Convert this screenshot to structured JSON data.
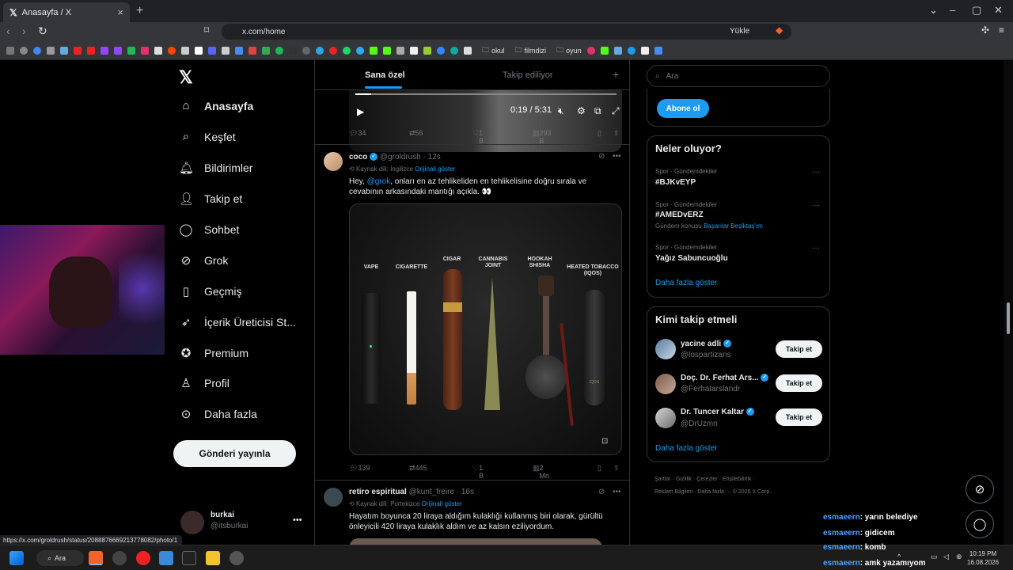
{
  "browser": {
    "tab_title": "Anasayfa / X",
    "url": "x.com/home",
    "download_label": "Yükle",
    "bookmark_folders": [
      "okul",
      "filmdizi",
      "oyun"
    ],
    "status_url": "https://x.com/groldrush/status/20888766692137780​82/photo/1"
  },
  "nav": {
    "items": [
      "Anasayfa",
      "Keşfet",
      "Bildirimler",
      "Takip et",
      "Sohbet",
      "Grok",
      "Geçmiş",
      "İçerik Üreticisi St...",
      "Premium",
      "Profil",
      "Daha fazla"
    ],
    "post_button": "Gönderi yayınla",
    "account_name": "burkai",
    "account_handle": "@itsburkai"
  },
  "timeline": {
    "tab_for_you": "Sana özel",
    "tab_following": "Takip ediliyor",
    "video": {
      "time": "0:19 / 5:31",
      "progress": 0.06
    },
    "post0_stats": {
      "replies": "34",
      "reposts": "56",
      "likes": "1 B",
      "views": "293 B"
    },
    "post1": {
      "name": "coco",
      "handle": "@groldrush",
      "time": "· 12s",
      "lang_note": "Kaynak dili: İngilizce",
      "show_original": "Orijinali göster",
      "text_before": "Hey, ",
      "mention": "@grok",
      "text_after": ", onları en az tehlikeliden en tehlikelisine doğru sırala ve cevabının arkasındaki mantığı açıkla. 👀",
      "labels": [
        "VAPE",
        "CIGARETTE",
        "CIGAR",
        "CANNABIS JOINT",
        "HOOKAH SHISHA",
        "HEATED TOBACCO (IQOS)"
      ],
      "iqos_mark": "IQOS",
      "stats": {
        "replies": "139",
        "reposts": "445",
        "likes": "1 B",
        "views": "2 Mn"
      }
    },
    "post2": {
      "name": "retiro espiritual",
      "handle": "@kunt_freire",
      "time": "· 16s",
      "lang_note": "Kaynak dili: Portekizce",
      "show_original": "Orijinali göster",
      "text": "Hayatım boyunca 20 liraya aldığım kulaklığı kullanmış biri olarak, gürültü önleyicili 420 liraya kulaklık aldım ve az kalsın eziliyordum."
    }
  },
  "sidebar": {
    "search_placeholder": "Ara",
    "subscribe": "Abone ol",
    "trends_title": "Neler oluyor?",
    "trends": [
      {
        "category": "Spor · Gündemdekiler",
        "name": "#BJKvEYP"
      },
      {
        "category": "Spor · Gündemdekiler",
        "name": "#AMEDvERZ",
        "extra_label": "Gündem konusu",
        "extra_link": "Başarılar Beşiktaş'ım"
      },
      {
        "category": "Spor · Gündemdekiler",
        "name": "Yağız Sabuncuoğlu"
      }
    ],
    "show_more": "Daha fazla göster",
    "wtf_title": "Kimi takip etmeli",
    "wtf": [
      {
        "name": "yacine adli",
        "handle": "@lospartizans"
      },
      {
        "name": "Doç. Dr. Ferhat Ars...",
        "handle": "@Ferhatarslandr"
      },
      {
        "name": "Dr. Tuncer Kaltar",
        "handle": "@DrUzmn"
      }
    ],
    "follow_label": "Takip et",
    "footer_line1": "Şartlar · Gizlilik · Çerezler · Erişilebilirlik ·",
    "footer_line2": "Reklam Bilgileri · Daha fazla ··· © 2026 X Corp."
  },
  "chat": [
    {
      "user": "esmaeern",
      "msg": ": yarın belediye"
    },
    {
      "user": "esmaeern",
      "msg": ": gidicem"
    },
    {
      "user": "esmaeern",
      "msg": ": komb"
    },
    {
      "user": "esmaeern",
      "msg": ": amk yazamıyom"
    }
  ],
  "taskbar": {
    "search": "Ara",
    "time": "10:19 PM",
    "date": "16.08.2026"
  },
  "colors": {
    "accent": "#1d9bf0",
    "bg": "#000000",
    "border": "#2f3336",
    "muted": "#71767b"
  }
}
